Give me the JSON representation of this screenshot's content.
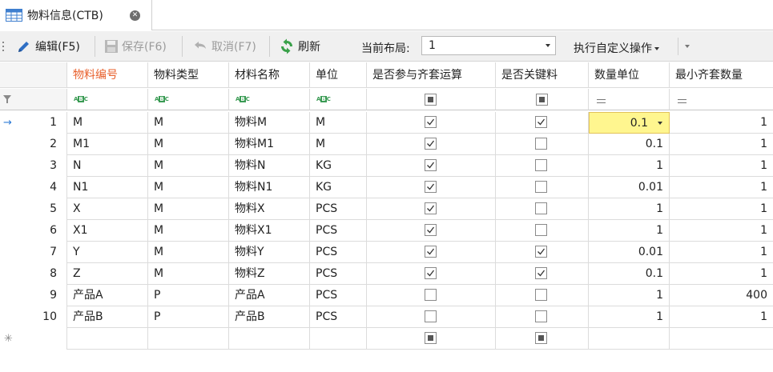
{
  "tab": {
    "title": "物料信息(CTB)"
  },
  "toolbar": {
    "edit_label": "编辑(F5)",
    "save_label": "保存(F6)",
    "cancel_label": "取消(F7)",
    "refresh_label": "刷新",
    "layout_label": "当前布局:",
    "layout_value": "1",
    "custom_action_label": "执行自定义操作"
  },
  "grid": {
    "columns": [
      "物料编号",
      "物料类型",
      "材料名称",
      "单位",
      "是否参与齐套运算",
      "是否关键料",
      "数量单位",
      "最小齐套数量"
    ],
    "sorted_column": "物料编号",
    "rows": [
      {
        "no": "1",
        "code": "M",
        "type": "M",
        "name": "物料M",
        "unit": "M",
        "in_calc": true,
        "key": true,
        "qty_unit": "0.1",
        "min_qty": "1"
      },
      {
        "no": "2",
        "code": "M1",
        "type": "M",
        "name": "物料M1",
        "unit": "M",
        "in_calc": true,
        "key": false,
        "qty_unit": "0.1",
        "min_qty": "1"
      },
      {
        "no": "3",
        "code": "N",
        "type": "M",
        "name": "物料N",
        "unit": "KG",
        "in_calc": true,
        "key": false,
        "qty_unit": "1",
        "min_qty": "1"
      },
      {
        "no": "4",
        "code": "N1",
        "type": "M",
        "name": "物料N1",
        "unit": "KG",
        "in_calc": true,
        "key": false,
        "qty_unit": "0.01",
        "min_qty": "1"
      },
      {
        "no": "5",
        "code": "X",
        "type": "M",
        "name": "物料X",
        "unit": "PCS",
        "in_calc": true,
        "key": false,
        "qty_unit": "1",
        "min_qty": "1"
      },
      {
        "no": "6",
        "code": "X1",
        "type": "M",
        "name": "物料X1",
        "unit": "PCS",
        "in_calc": true,
        "key": false,
        "qty_unit": "1",
        "min_qty": "1"
      },
      {
        "no": "7",
        "code": "Y",
        "type": "M",
        "name": "物料Y",
        "unit": "PCS",
        "in_calc": true,
        "key": true,
        "qty_unit": "0.01",
        "min_qty": "1"
      },
      {
        "no": "8",
        "code": "Z",
        "type": "M",
        "name": "物料Z",
        "unit": "PCS",
        "in_calc": true,
        "key": true,
        "qty_unit": "0.1",
        "min_qty": "1"
      },
      {
        "no": "9",
        "code": "产品A",
        "type": "P",
        "name": "产品A",
        "unit": "PCS",
        "in_calc": false,
        "key": false,
        "qty_unit": "1",
        "min_qty": "400"
      },
      {
        "no": "10",
        "code": "产品B",
        "type": "P",
        "name": "产品B",
        "unit": "PCS",
        "in_calc": false,
        "key": false,
        "qty_unit": "1",
        "min_qty": "1"
      }
    ],
    "focused_row": "1",
    "colors": {
      "sorted_header": "#e8602c",
      "focused_cell": "#fff68f",
      "row_indicator": "#2e7bd6"
    }
  }
}
